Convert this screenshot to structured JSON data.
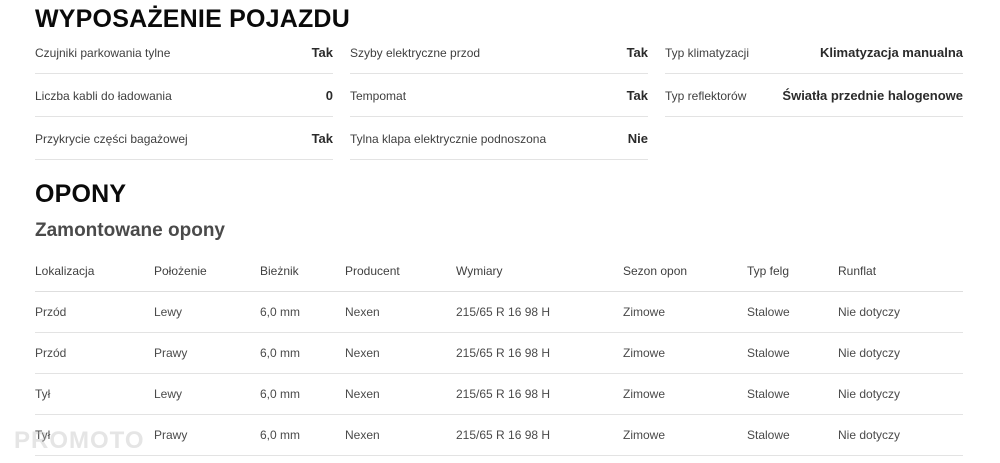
{
  "equipment": {
    "title": "WYPOSAŻENIE POJAZDU",
    "columns": [
      [
        {
          "label": "Czujniki parkowania tylne",
          "value": "Tak"
        },
        {
          "label": "Liczba kabli do ładowania",
          "value": "0"
        },
        {
          "label": "Przykrycie części bagażowej",
          "value": "Tak"
        }
      ],
      [
        {
          "label": "Szyby elektryczne przod",
          "value": "Tak"
        },
        {
          "label": "Tempomat",
          "value": "Tak"
        },
        {
          "label": "Tylna klapa elektrycznie podnoszona",
          "value": "Nie"
        }
      ],
      [
        {
          "label": "Typ klimatyzacji",
          "value": "Klimatyzacja manualna"
        },
        {
          "label": "Typ reflektorów",
          "value": "Światła przednie halogenowe"
        }
      ]
    ]
  },
  "tires": {
    "title": "OPONY",
    "subtitle": "Zamontowane opony",
    "headers": [
      "Lokalizacja",
      "Położenie",
      "Bieżnik",
      "Producent",
      "Wymiary",
      "Sezon opon",
      "Typ felg",
      "Runflat"
    ],
    "rows": [
      [
        "Przód",
        "Lewy",
        "6,0 mm",
        "Nexen",
        "215/65 R 16 98 H",
        "Zimowe",
        "Stalowe",
        "Nie dotyczy"
      ],
      [
        "Przód",
        "Prawy",
        "6,0 mm",
        "Nexen",
        "215/65 R 16 98 H",
        "Zimowe",
        "Stalowe",
        "Nie dotyczy"
      ],
      [
        "Tył",
        "Lewy",
        "6,0 mm",
        "Nexen",
        "215/65 R 16 98 H",
        "Zimowe",
        "Stalowe",
        "Nie dotyczy"
      ],
      [
        "Tył",
        "Prawy",
        "6,0 mm",
        "Nexen",
        "215/65 R 16 98 H",
        "Zimowe",
        "Stalowe",
        "Nie dotyczy"
      ]
    ]
  },
  "watermark": "PROMOTO"
}
